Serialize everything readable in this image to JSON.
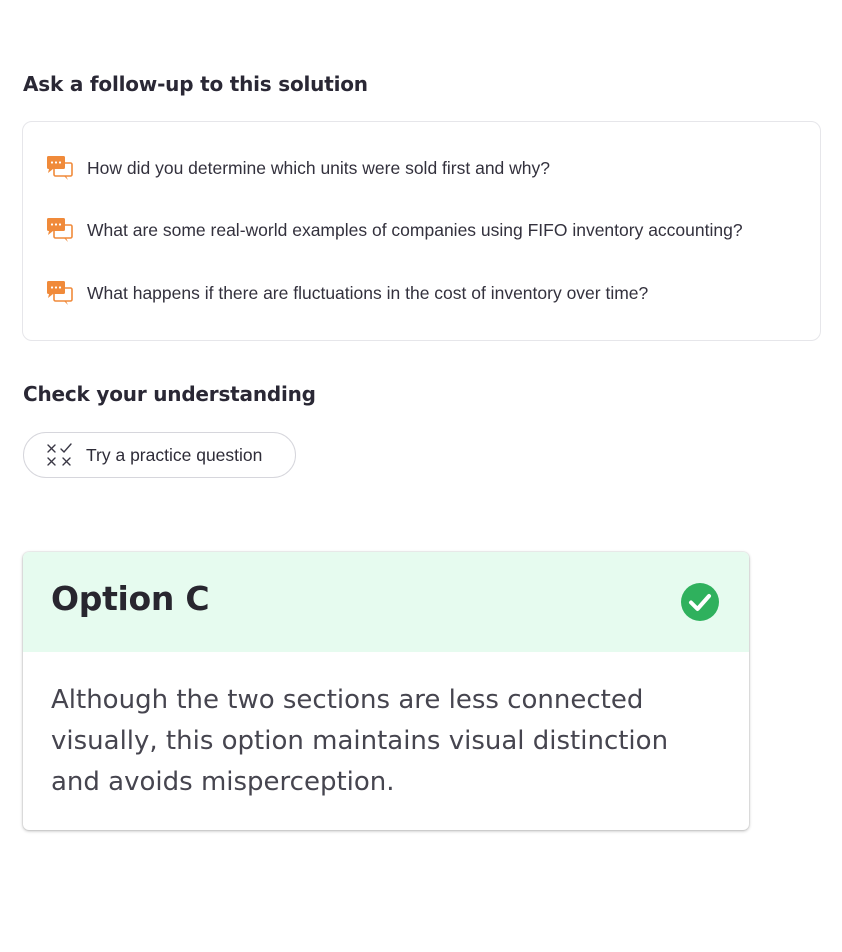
{
  "followup": {
    "title": "Ask a follow-up to this solution",
    "items": [
      {
        "label": "How did you determine which units were sold first and why?",
        "icon": "chat-bubbles-icon"
      },
      {
        "label": "What are some real-world examples of companies using FIFO inventory accounting?",
        "icon": "chat-bubbles-icon"
      },
      {
        "label": "What happens if there are fluctuations in the cost of inventory over time?",
        "icon": "chat-bubbles-icon"
      }
    ]
  },
  "check": {
    "title": "Check your understanding",
    "practice_button": {
      "label": "Try a practice question",
      "icon": "check-cross-grid-icon"
    }
  },
  "option_card": {
    "title": "Option C",
    "status_icon": "check-circle-icon",
    "body": "Although the two sections are less connected visually, this option maintains visual distinction and avoids misperception."
  },
  "colors": {
    "accent_orange": "#f08a3a",
    "success_green": "#2fb15d",
    "header_green_bg": "#e6fbef"
  }
}
